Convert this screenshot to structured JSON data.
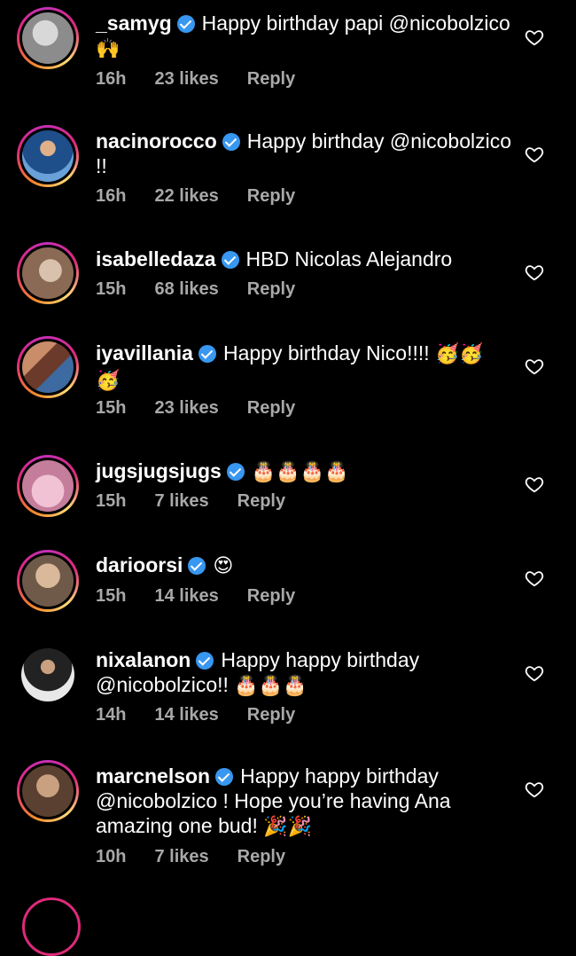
{
  "comments": [
    {
      "username": "_samyg",
      "text": "Happy birthday papi @nicobolzico",
      "emoji": "🙌",
      "time": "16h",
      "likes": "23 likes",
      "reply": "Reply",
      "avatar_colors": [
        "#8c8c8c",
        "#d8d8d8"
      ]
    },
    {
      "username": "nacinorocco",
      "text": "Happy birthday @nicobolzico !!",
      "emoji": "",
      "time": "16h",
      "likes": "22 likes",
      "reply": "Reply",
      "avatar_colors": [
        "#1e4f8a",
        "#6aa0d8"
      ]
    },
    {
      "username": "isabelledaza",
      "text": "HBD Nicolas Alejandro",
      "emoji": "",
      "time": "15h",
      "likes": "68 likes",
      "reply": "Reply",
      "avatar_colors": [
        "#8a6a55",
        "#d9c2ad"
      ]
    },
    {
      "username": "iyavillania",
      "text": "Happy birthday Nico!!!!",
      "emoji": "🥳🥳🥳",
      "time": "15h",
      "likes": "23 likes",
      "reply": "Reply",
      "avatar_colors": [
        "#6c3a2a",
        "#c98d6a"
      ]
    },
    {
      "username": "jugsjugsjugs",
      "text": "",
      "emoji": "🎂🎂🎂🎂",
      "time": "15h",
      "likes": "7 likes",
      "reply": "Reply",
      "avatar_colors": [
        "#c47d9b",
        "#f0c2d3"
      ]
    },
    {
      "username": "darioorsi",
      "text": "",
      "emoji": "😍",
      "time": "15h",
      "likes": "14 likes",
      "reply": "Reply",
      "avatar_colors": [
        "#6f5a4a",
        "#d9b99a"
      ]
    },
    {
      "username": "nixalanon",
      "text": "Happy happy birthday @nicobolzico!!",
      "emoji": "🎂🎂🎂",
      "time": "14h",
      "likes": "14 likes",
      "reply": "Reply",
      "avatar_colors": [
        "#222",
        "#e8e8e8"
      ]
    },
    {
      "username": "marcnelson",
      "text": "Happy happy birthday @nicobolzico ! Hope you’re having Ana amazing one bud!",
      "emoji": "🎉🎉",
      "time": "10h",
      "likes": "7 likes",
      "reply": "Reply",
      "avatar_colors": [
        "#5a4030",
        "#c9a080"
      ]
    }
  ],
  "icons": {
    "verified": "verified-badge-icon",
    "heart": "heart-outline-icon"
  },
  "colors": {
    "verified": "#3897f0",
    "meta": "#a8a8a8",
    "ring_start": "#f58529",
    "ring_end": "#dd2a7b"
  }
}
